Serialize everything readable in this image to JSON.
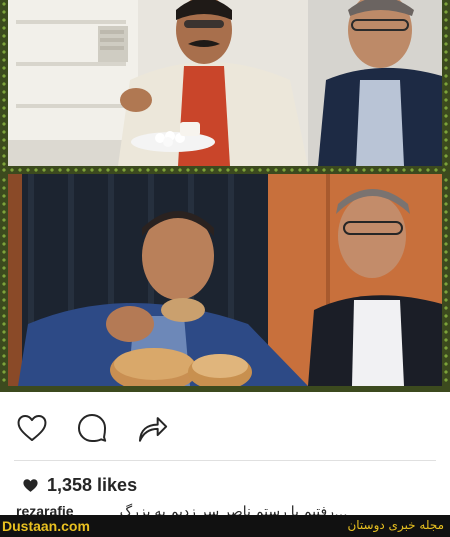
{
  "post": {
    "likes_count": "1,358 likes",
    "caption_username": "rezarafie",
    "caption_text": "…رفتیم با رستم ناصر سر زدیم به بزرگ"
  },
  "icons": {
    "like": "heart-outline-icon",
    "comment": "speech-bubble-icon",
    "share": "share-arrow-icon",
    "likes_heart": "heart-filled-icon"
  },
  "watermark": {
    "site": "Dustaan.com",
    "tagline": "مجله خبری دوستان"
  },
  "colors": {
    "frame": "#3c4a1e",
    "frame_dots": "#7da33a",
    "banner_bg": "#111111",
    "banner_text": "#e8c020",
    "text": "#262626"
  }
}
